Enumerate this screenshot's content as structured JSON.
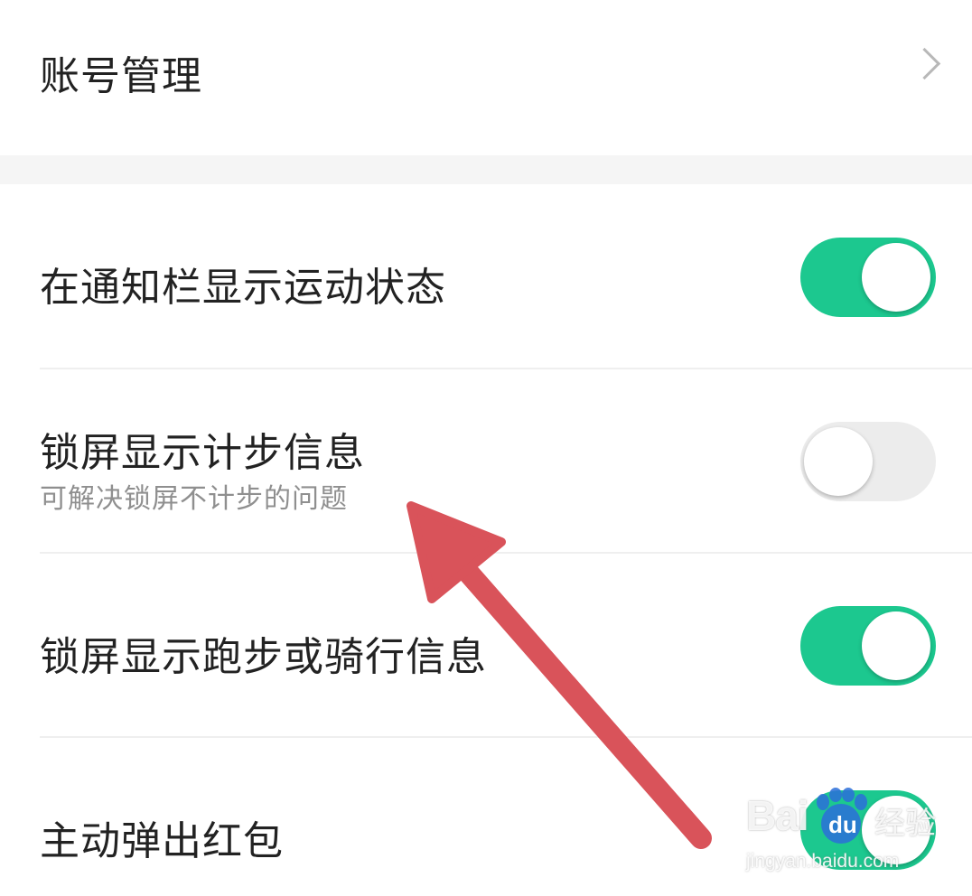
{
  "settings": {
    "account": {
      "label": "账号管理",
      "icon": "chevron-right-icon"
    },
    "items": [
      {
        "label": "在通知栏显示运动状态",
        "subtitle": "",
        "enabled": true
      },
      {
        "label": "锁屏显示计步信息",
        "subtitle": "可解决锁屏不计步的问题",
        "enabled": false
      },
      {
        "label": "锁屏显示跑步或骑行信息",
        "subtitle": "",
        "enabled": true
      },
      {
        "label": "主动弹出红包",
        "subtitle": "",
        "enabled": true
      }
    ]
  },
  "colors": {
    "toggle_on": "#1cc88f",
    "toggle_off": "#ececec",
    "arrow": "#d9535a",
    "title_text": "#222222",
    "subtitle_text": "#8f8f8f"
  },
  "watermark": {
    "brand": "Bai",
    "du": "du",
    "cn": "经验",
    "url": "jingyan.baidu.com"
  }
}
